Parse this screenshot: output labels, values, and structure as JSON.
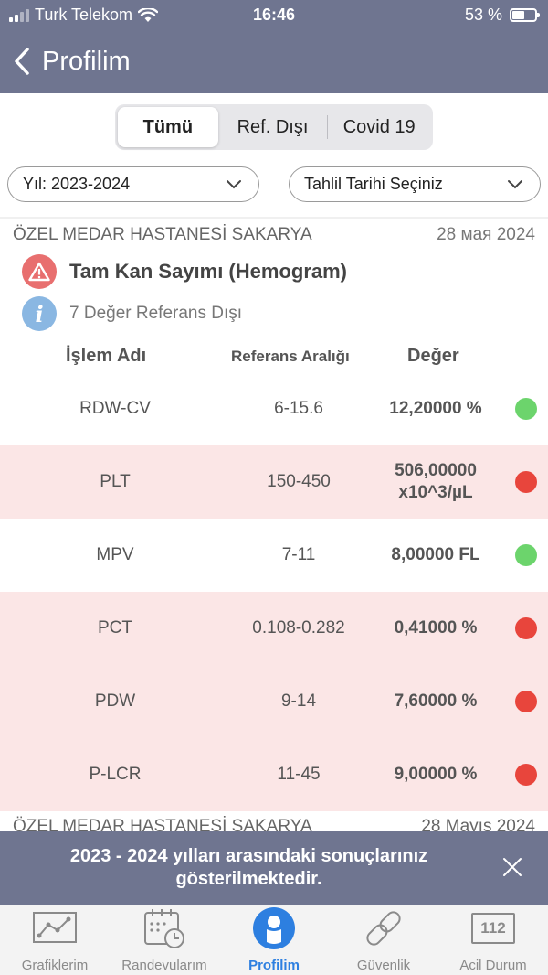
{
  "status_bar": {
    "carrier": "Turk Telekom",
    "time": "16:46",
    "battery": "53 %",
    "battery_level": 0.53
  },
  "nav": {
    "title": "Profilim"
  },
  "segments": [
    {
      "label": "Tümü",
      "active": true
    },
    {
      "label": "Ref. Dışı",
      "active": false
    },
    {
      "label": "Covid 19",
      "active": false
    }
  ],
  "filters": {
    "year": "Yıl: 2023-2024",
    "date": "Tahlil Tarihi Seçiniz"
  },
  "result": {
    "hospital": "ÖZEL MEDAR HASTANESİ SAKARYA",
    "date": "28 мая 2024",
    "test_name": "Tam Kan Sayımı (Hemogram)",
    "out_of_range": "7 Değer Referans Dışı"
  },
  "table": {
    "headers": {
      "name": "İşlem Adı",
      "ref": "Referans Aralığı",
      "value": "Değer"
    },
    "rows": [
      {
        "name": "RDW-CV",
        "ref": "6-15.6",
        "value": "12,20000 %",
        "value2": "",
        "status": "normal"
      },
      {
        "name": "PLT",
        "ref": "150-450",
        "value": "506,00000",
        "value2": "x10^3/µL",
        "status": "out"
      },
      {
        "name": "MPV",
        "ref": "7-11",
        "value": "8,00000 FL",
        "value2": "",
        "status": "normal"
      },
      {
        "name": "PCT",
        "ref": "0.108-0.282",
        "value": "0,41000 %",
        "value2": "",
        "status": "out"
      },
      {
        "name": "PDW",
        "ref": "9-14",
        "value": "7,60000 %",
        "value2": "",
        "status": "out"
      },
      {
        "name": "P-LCR",
        "ref": "11-45",
        "value": "9,00000 %",
        "value2": "",
        "status": "out"
      }
    ]
  },
  "next_result": {
    "hospital": "ÖZEL MEDAR HASTANESİ SAKARYA",
    "date": "28 Mayıs 2024"
  },
  "toast": {
    "text": "2023 - 2024 yılları arasındaki sonuçlarınız gösterilmektedir."
  },
  "tabs": [
    {
      "label": "Grafiklerim",
      "icon": "chart-icon",
      "active": false
    },
    {
      "label": "Randevularım",
      "icon": "calendar-icon",
      "active": false
    },
    {
      "label": "Profilim",
      "icon": "profile-icon",
      "active": true
    },
    {
      "label": "Güvenlik",
      "icon": "link-icon",
      "active": false
    },
    {
      "label": "Acil Durum",
      "icon": "emergency-112-icon",
      "active": false,
      "icon_text": "112"
    }
  ],
  "colors": {
    "header": "#6f7590",
    "out_row": "#fbe6e6",
    "green_dot": "#6cd46c",
    "red_dot": "#e8453c",
    "accent": "#2d7fe0"
  }
}
